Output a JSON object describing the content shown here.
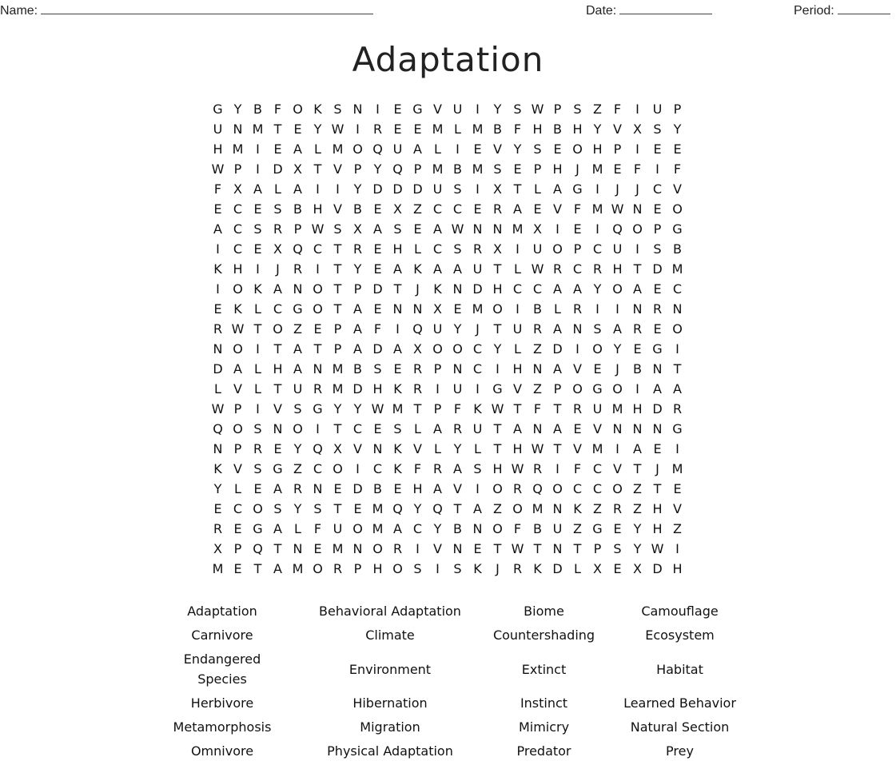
{
  "header": {
    "name_label": "Name:",
    "date_label": "Date:",
    "period_label": "Period:"
  },
  "title": "Adaptation",
  "grid": [
    "GYBFOKSNIEGVUIYSWPSZFIUP",
    "UNMTEYWIREEMLMBFHBHYVXSY",
    "HMIEALMOQUALIEVYSEOHPIEE",
    "WPIDXTVPYQPMBMSEPHJMEFIF",
    "FXALAIIYDDDUSIXTLAGIJJCV",
    "ECESBHVBEXZCCERAEVFMWNEO",
    "ACSRPWSXASEAWNNMXIEIQOPG",
    "ICEXQCTREHLCSRXIUOPCUISB",
    "KHIJRITYEAKAAUTLWRCRHTDM",
    "IOKANOTPDTJKNDHCCAAYOAEC",
    "EKLCGOTAENNXEMOIBLRIINRN",
    "RWTOZEPAFIQUYJTURANSAREO",
    "NOITATPADAXOOCYLZDIOYEGI",
    "DALHANMBSERPNCIHNAVEJBNT",
    "LVLTURMDHKRIUIGVZPOGOIAA",
    "WPIVSGYYWMTPFKWTFTRUMHDR",
    "QOSNOITCESLARUTANAEVNNNG",
    "NPREYQXVNKVLYLTHWTVMIAEI",
    "KVSGZCOICKFRASHWRIFCVTJM",
    "YLEARNEDBEHAVIORQOCCOZTE",
    "ECOSYSTEMQYQTAZOMNKZRZHV",
    "REGALFUOMACYBNOFBUZGEYHZ",
    "XPQTNEMNORIVNETWTNTPSYWI",
    "METAMORPHOSISKJRKDLXEXDH"
  ],
  "word_list": [
    "Adaptation",
    "Behavioral Adaptation",
    "Biome",
    "Camouflage",
    "Carnivore",
    "Climate",
    "Countershading",
    "Ecosystem",
    "Endangered Species",
    "Environment",
    "Extinct",
    "Habitat",
    "Herbivore",
    "Hibernation",
    "Instinct",
    "Learned Behavior",
    "Metamorphosis",
    "Migration",
    "Mimicry",
    "Natural Section",
    "Omnivore",
    "Physical Adaptation",
    "Predator",
    "Prey"
  ]
}
